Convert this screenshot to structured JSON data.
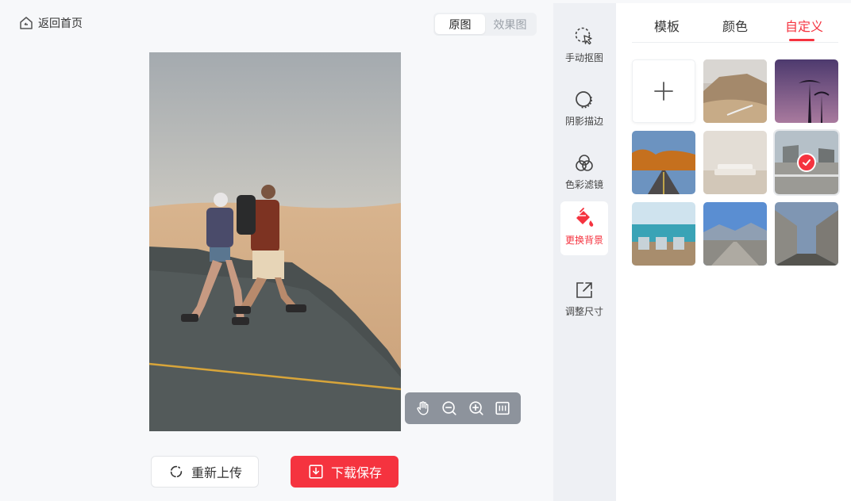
{
  "header": {
    "back_label": "返回首页"
  },
  "view_toggle": {
    "original": "原图",
    "result": "效果图",
    "active": "原图"
  },
  "actions": {
    "reupload": "重新上传",
    "download": "下载保存"
  },
  "tools": [
    {
      "label": "手动抠图",
      "icon": "cursor-select-icon"
    },
    {
      "label": "阴影描边",
      "icon": "shadow-outline-icon"
    },
    {
      "label": "色彩滤镜",
      "icon": "color-filter-icon"
    },
    {
      "label": "更换背景",
      "icon": "paint-bucket-icon",
      "active": true
    },
    {
      "label": "调整尺寸",
      "icon": "resize-icon"
    }
  ],
  "panel": {
    "tabs": [
      {
        "label": "模板"
      },
      {
        "label": "颜色"
      },
      {
        "label": "自定义",
        "active": true
      }
    ]
  },
  "colors": {
    "accent": "#f5333f",
    "sidebar_bg": "#eef0f4",
    "canvas_bg": "#f7f8fa"
  }
}
